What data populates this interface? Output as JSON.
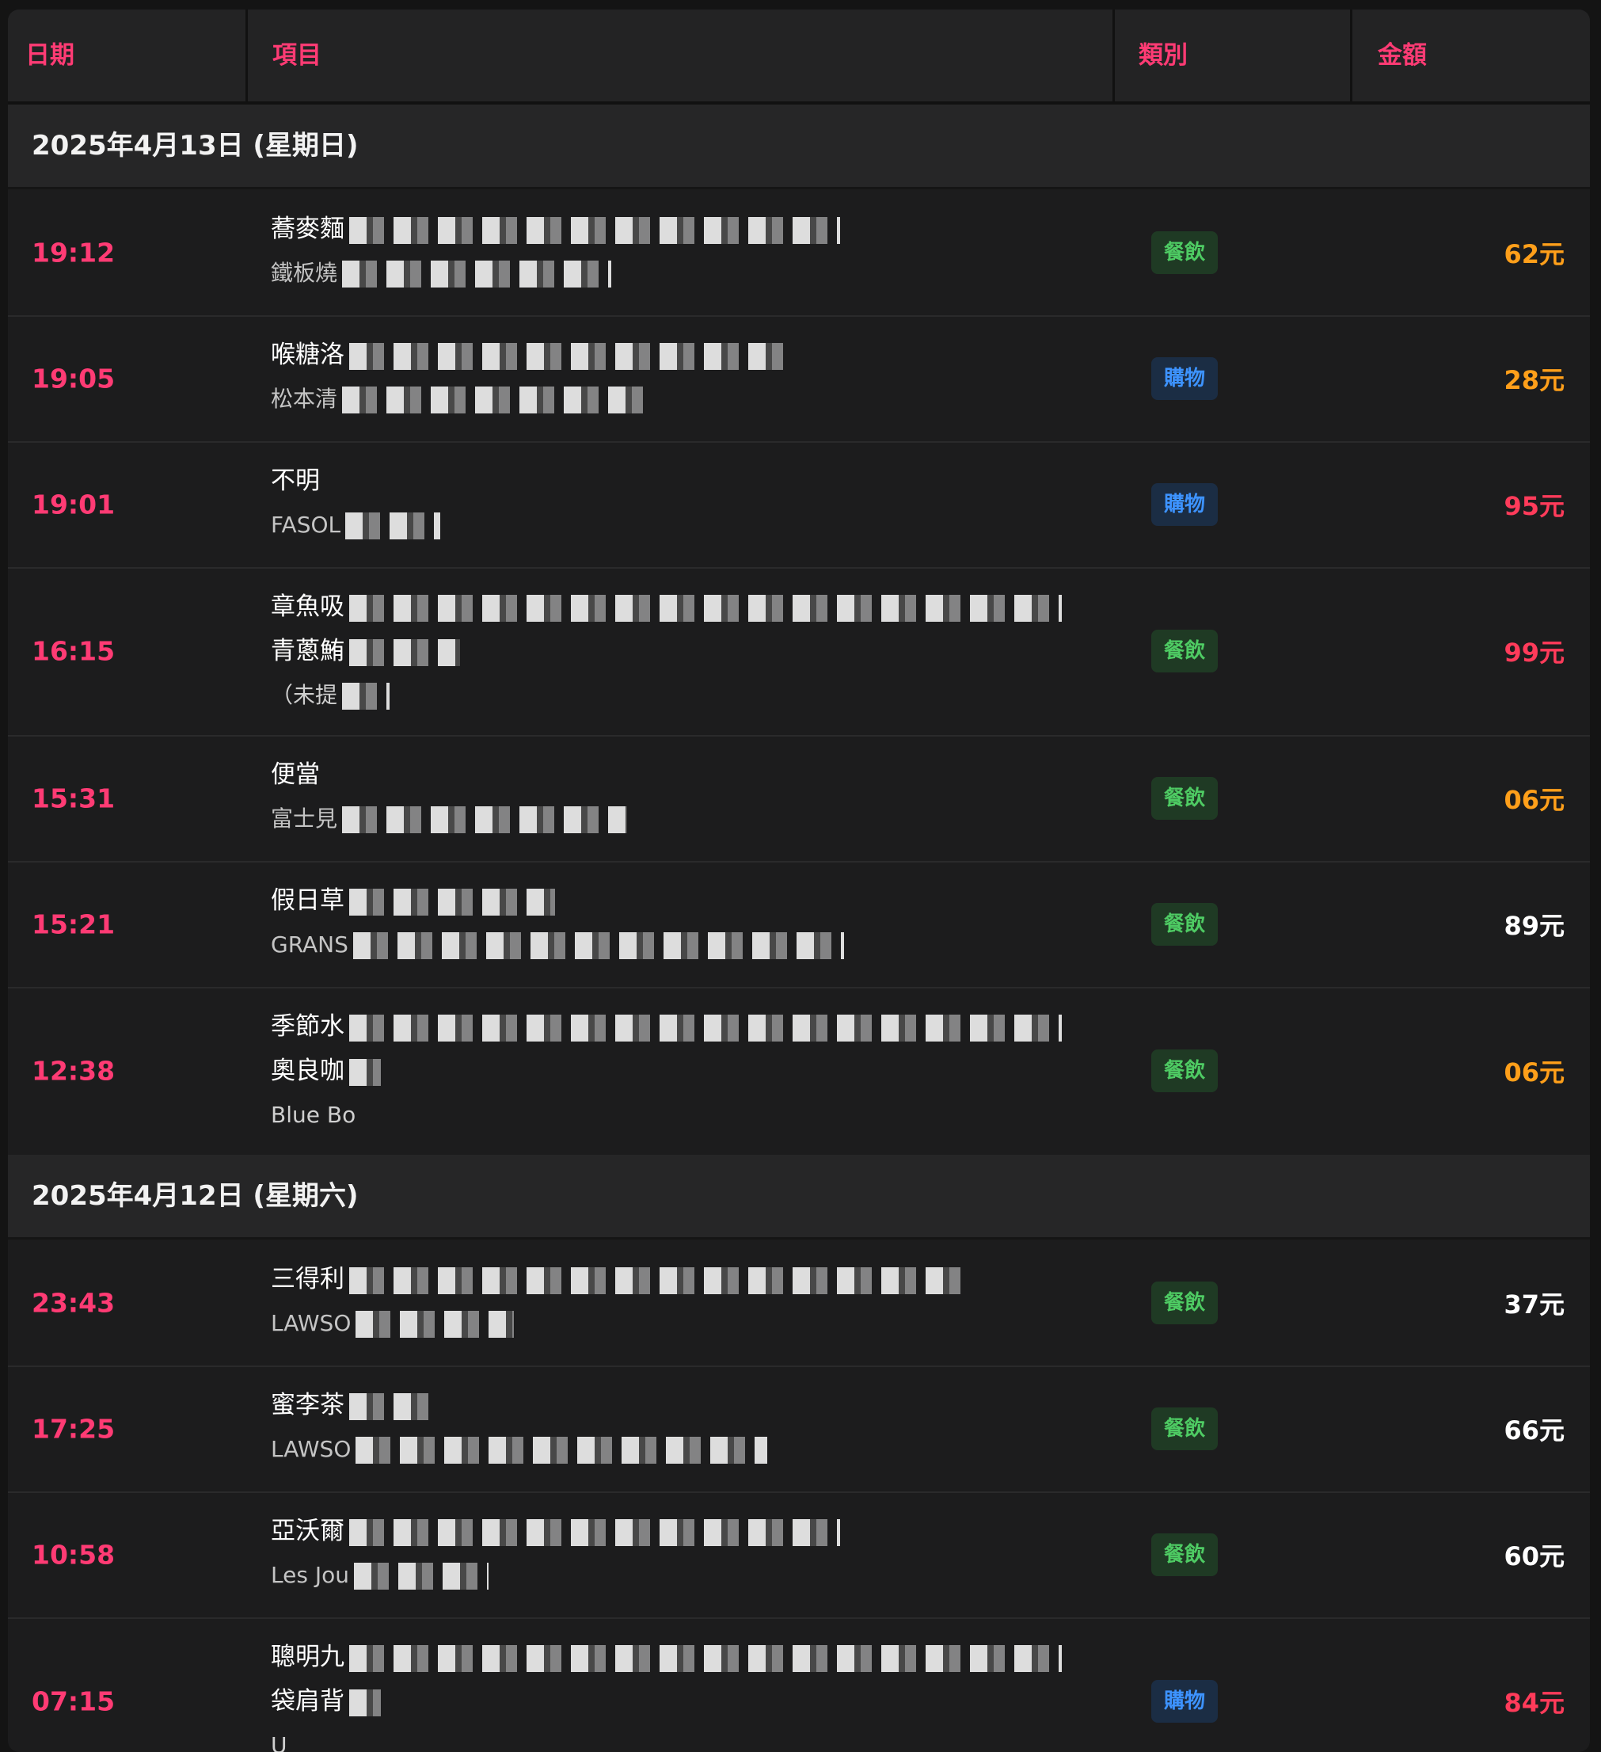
{
  "header": {
    "col_date": "日期",
    "col_item": "項目",
    "col_category": "類別",
    "col_amount": "金額"
  },
  "groups": [
    {
      "date": "2025年4月13日 (星期日)",
      "rows": [
        {
          "time": "19:12",
          "lines": [
            "蕎麥麵",
            "鐵板燒"
          ],
          "category": "餐飲",
          "amount": "62元",
          "amount_color": "orange"
        },
        {
          "time": "19:05",
          "lines": [
            "喉糖洛",
            "松本清"
          ],
          "category": "購物",
          "amount": "28元",
          "amount_color": "orange"
        },
        {
          "time": "19:01",
          "lines": [
            "不明",
            "FASOL"
          ],
          "category": "購物",
          "amount": "95元",
          "amount_color": "red"
        },
        {
          "time": "16:15",
          "lines": [
            "章魚吸",
            "青蔥鮪",
            "（未提"
          ],
          "category": "餐飲",
          "amount": "99元",
          "amount_color": "red"
        },
        {
          "time": "15:31",
          "lines": [
            "便當",
            "富士見"
          ],
          "category": "餐飲",
          "amount": "06元",
          "amount_color": "orange"
        },
        {
          "time": "15:21",
          "lines": [
            "假日草",
            "GRANS"
          ],
          "category": "餐飲",
          "amount": "89元",
          "amount_color": "white"
        },
        {
          "time": "12:38",
          "lines": [
            "季節水",
            "奧良咖",
            "Blue Bo"
          ],
          "category": "餐飲",
          "amount": "06元",
          "amount_color": "orange"
        }
      ]
    },
    {
      "date": "2025年4月12日 (星期六)",
      "rows": [
        {
          "time": "23:43",
          "lines": [
            "三得利",
            "LAWSO"
          ],
          "category": "餐飲",
          "amount": "37元",
          "amount_color": "white"
        },
        {
          "time": "17:25",
          "lines": [
            "蜜李茶",
            "LAWSO"
          ],
          "category": "餐飲",
          "amount": "66元",
          "amount_color": "white"
        },
        {
          "time": "10:58",
          "lines": [
            "亞沃爾",
            "Les Jou"
          ],
          "category": "餐飲",
          "amount": "60元",
          "amount_color": "white"
        },
        {
          "time": "07:15",
          "lines": [
            "聰明九",
            "袋肩背",
            "U"
          ],
          "category": "購物",
          "amount": "84元",
          "amount_color": "red"
        }
      ]
    }
  ]
}
